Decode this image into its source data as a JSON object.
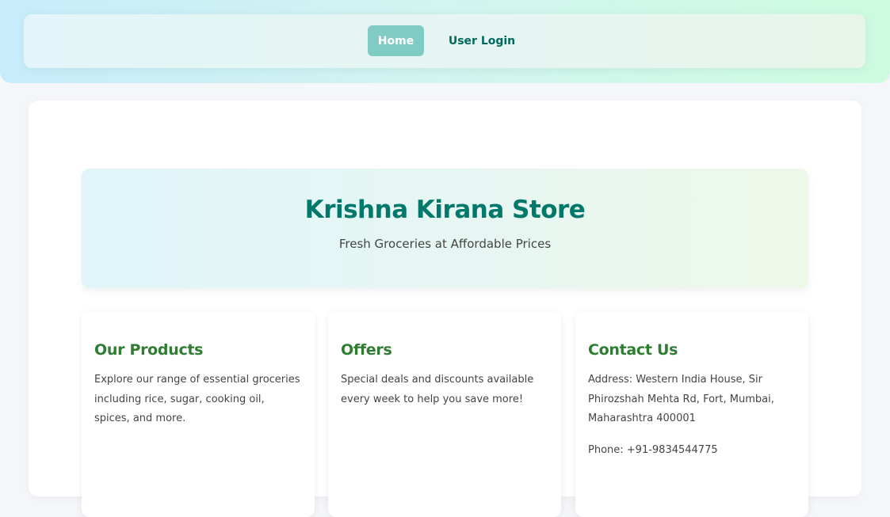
{
  "nav": {
    "home_label": "Home",
    "login_label": "User Login"
  },
  "hero": {
    "title": "Krishna Kirana Store",
    "subtitle": "Fresh Groceries at Affordable Prices"
  },
  "cards": [
    {
      "title": "Our Products",
      "text": "Explore our range of essential groceries including rice, sugar, cooking oil, spices, and more."
    },
    {
      "title": "Offers",
      "text": "Special deals and discounts available every week to help you save more!"
    },
    {
      "title": "Contact Us",
      "address": "Address: Western India House, Sir Phirozshah Mehta Rd, Fort, Mumbai, Maharashtra 400001",
      "phone": "Phone: +91-9834544775"
    }
  ],
  "colors": {
    "nav_active": "#80cbc4",
    "title_teal": "#00796b",
    "card_title_green": "#2e7d32"
  }
}
